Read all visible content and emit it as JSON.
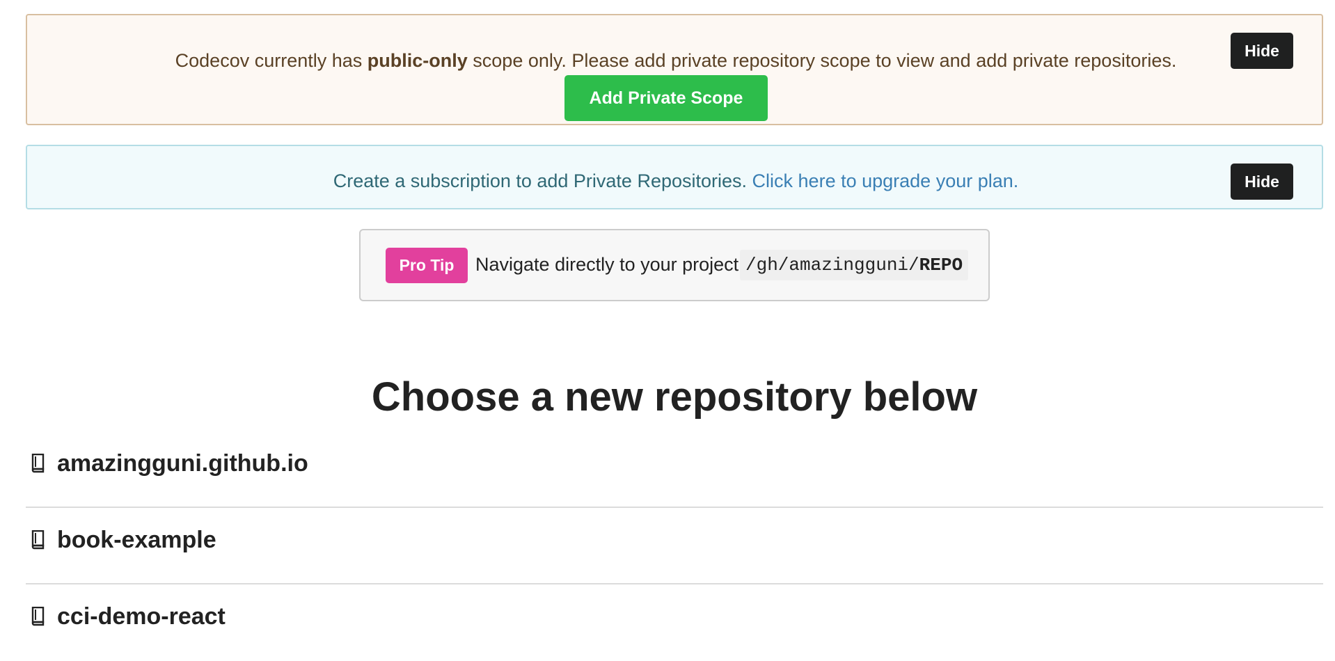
{
  "alerts": {
    "scope": {
      "text_before": "Codecov currently has ",
      "text_bold": "public-only",
      "text_after": " scope only. Please add private repository scope to view and add private repositories.",
      "button_label": "Add Private Scope",
      "hide_label": "Hide"
    },
    "subscription": {
      "text": "Create a subscription to add Private Repositories.",
      "link_text": "Click here to upgrade your plan.",
      "hide_label": "Hide"
    }
  },
  "protip": {
    "badge": "Pro Tip",
    "text": "Navigate directly to your project:",
    "code_prefix": "/gh/amazingguni/",
    "code_bold": "REPO"
  },
  "heading": "Choose a new repository below",
  "repositories": [
    {
      "name": "amazingguni.github.io",
      "icon": "repo-icon"
    },
    {
      "name": "book-example",
      "icon": "repo-icon"
    },
    {
      "name": "cci-demo-react",
      "icon": "repo-icon"
    }
  ],
  "colors": {
    "green": "#2dbd4b",
    "pink": "#e2409d",
    "dark_button": "#1f2020",
    "warning_bg": "#fdf8f3",
    "info_bg": "#f1fafc",
    "link": "#3a7fb4"
  }
}
